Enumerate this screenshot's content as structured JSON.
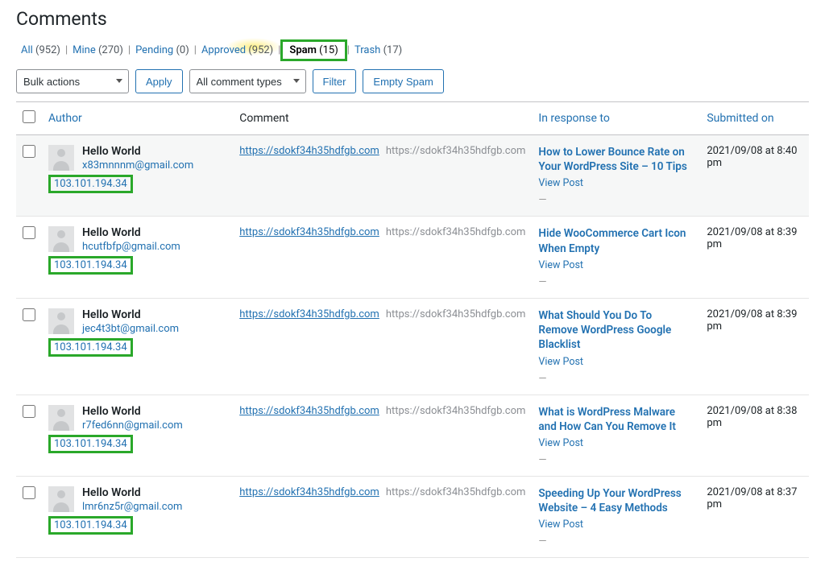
{
  "page": {
    "title": "Comments"
  },
  "filters": {
    "all": {
      "label": "All",
      "count": "(952)"
    },
    "mine": {
      "label": "Mine",
      "count": "(270)"
    },
    "pending": {
      "label": "Pending",
      "count": "(0)"
    },
    "approved": {
      "label": "Approved",
      "count": "(952)"
    },
    "spam": {
      "label": "Spam",
      "count": "(15)"
    },
    "trash": {
      "label": "Trash",
      "count": "(17)"
    }
  },
  "actions": {
    "bulk_placeholder": "Bulk actions",
    "apply": "Apply",
    "types_placeholder": "All comment types",
    "filter": "Filter",
    "empty_spam": "Empty Spam"
  },
  "columns": {
    "author": "Author",
    "comment": "Comment",
    "response": "In response to",
    "date": "Submitted on"
  },
  "rows": [
    {
      "author_name": "Hello World",
      "author_email": "x83mnnnm@gmail.com",
      "author_ip": "103.101.194.34",
      "comment_url": "https://sdokf34h35hdfgb.com",
      "comment_plain": "https://sdokf34h35hdfgb.com",
      "post_title": "How to Lower Bounce Rate on Your WordPress Site – 10 Tips",
      "view_post": "View Post",
      "date": "2021/09/08 at 8:40 pm"
    },
    {
      "author_name": "Hello World",
      "author_email": "hcutfbfp@gmail.com",
      "author_ip": "103.101.194.34",
      "comment_url": "https://sdokf34h35hdfgb.com",
      "comment_plain": "https://sdokf34h35hdfgb.com",
      "post_title": "Hide WooCommerce Cart Icon When Empty",
      "view_post": "View Post",
      "date": "2021/09/08 at 8:39 pm"
    },
    {
      "author_name": "Hello World",
      "author_email": "jec4t3bt@gmail.com",
      "author_ip": "103.101.194.34",
      "comment_url": "https://sdokf34h35hdfgb.com",
      "comment_plain": "https://sdokf34h35hdfgb.com",
      "post_title": "What Should You Do To Remove WordPress Google Blacklist",
      "view_post": "View Post",
      "date": "2021/09/08 at 8:39 pm"
    },
    {
      "author_name": "Hello World",
      "author_email": "r7fed6nn@gmail.com",
      "author_ip": "103.101.194.34",
      "comment_url": "https://sdokf34h35hdfgb.com",
      "comment_plain": "https://sdokf34h35hdfgb.com",
      "post_title": "What is WordPress Malware and How Can You Remove It",
      "view_post": "View Post",
      "date": "2021/09/08 at 8:38 pm"
    },
    {
      "author_name": "Hello World",
      "author_email": "lmr6nz5r@gmail.com",
      "author_ip": "103.101.194.34",
      "comment_url": "https://sdokf34h35hdfgb.com",
      "comment_plain": "https://sdokf34h35hdfgb.com",
      "post_title": "Speeding Up Your WordPress Website – 4 Easy Methods",
      "view_post": "View Post",
      "date": "2021/09/08 at 8:37 pm"
    }
  ]
}
